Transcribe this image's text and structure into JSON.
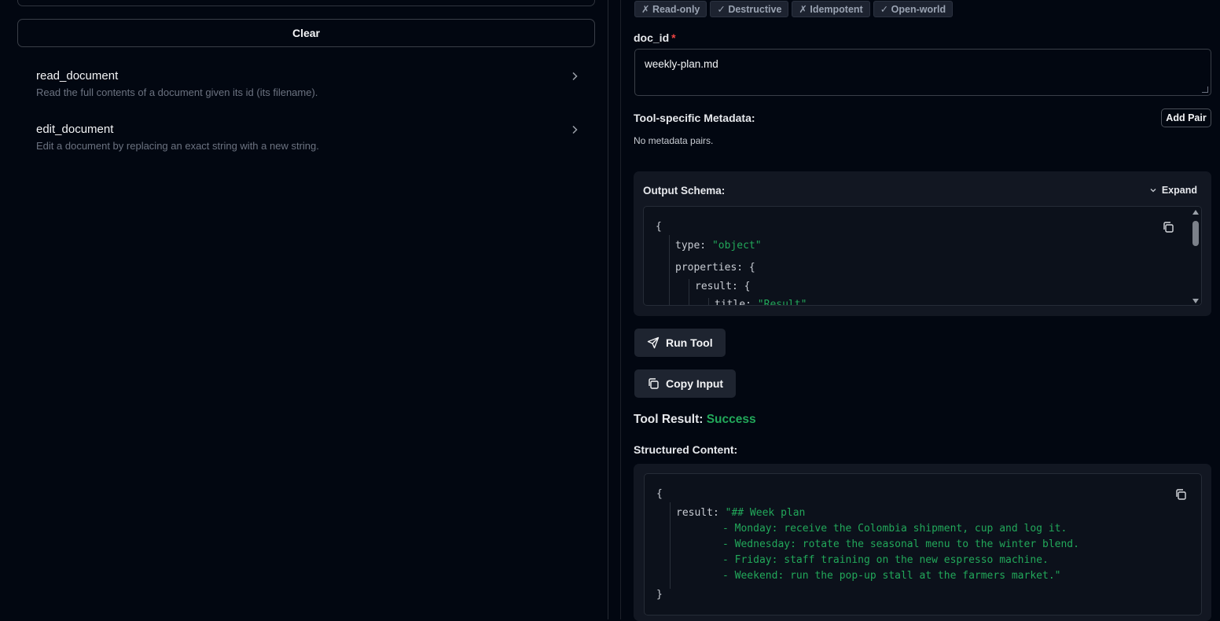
{
  "left": {
    "clear_label": "Clear",
    "tools": [
      {
        "name": "read_document",
        "description": "Read the full contents of a document given its id (its filename)."
      },
      {
        "name": "edit_document",
        "description": "Edit a document by replacing an exact string with a new string."
      }
    ]
  },
  "right": {
    "badges": [
      "✗ Read-only",
      "✓ Destructive",
      "✗ Idempotent",
      "✓ Open-world"
    ],
    "doc_id_label": "doc_id",
    "required_mark": "*",
    "doc_id_value": "weekly-plan.md",
    "metadata_title": "Tool-specific Metadata:",
    "add_pair_label": "Add Pair",
    "metadata_empty": "No metadata pairs.",
    "output_schema": {
      "title": "Output Schema:",
      "expand_label": "Expand",
      "lines": {
        "open": "{",
        "type_key": "type:",
        "type_val": "\"object\"",
        "props_key": "properties:",
        "props_open": "{",
        "result_key": "result:",
        "result_open": "{",
        "title_key": "title:",
        "title_val": "\"Result\""
      }
    },
    "run_tool_label": "Run Tool",
    "copy_input_label": "Copy Input",
    "result_heading": "Tool Result:",
    "result_status": "Success",
    "structured_label": "Structured Content:",
    "structured": {
      "open": "{",
      "result_key": "result:",
      "lines": [
        "\"## Week plan",
        "- Monday: receive the Colombia shipment, cup and log it.",
        "- Wednesday: rotate the seasonal menu to the winter blend.",
        "- Friday: staff training on the new espresso machine.",
        "- Weekend: run the pop-up stall at the farmers market.\""
      ],
      "close": "}"
    }
  },
  "colors": {
    "background": "#020711",
    "panel": "#121722",
    "success": "#22a85a",
    "required": "#ef4444"
  }
}
